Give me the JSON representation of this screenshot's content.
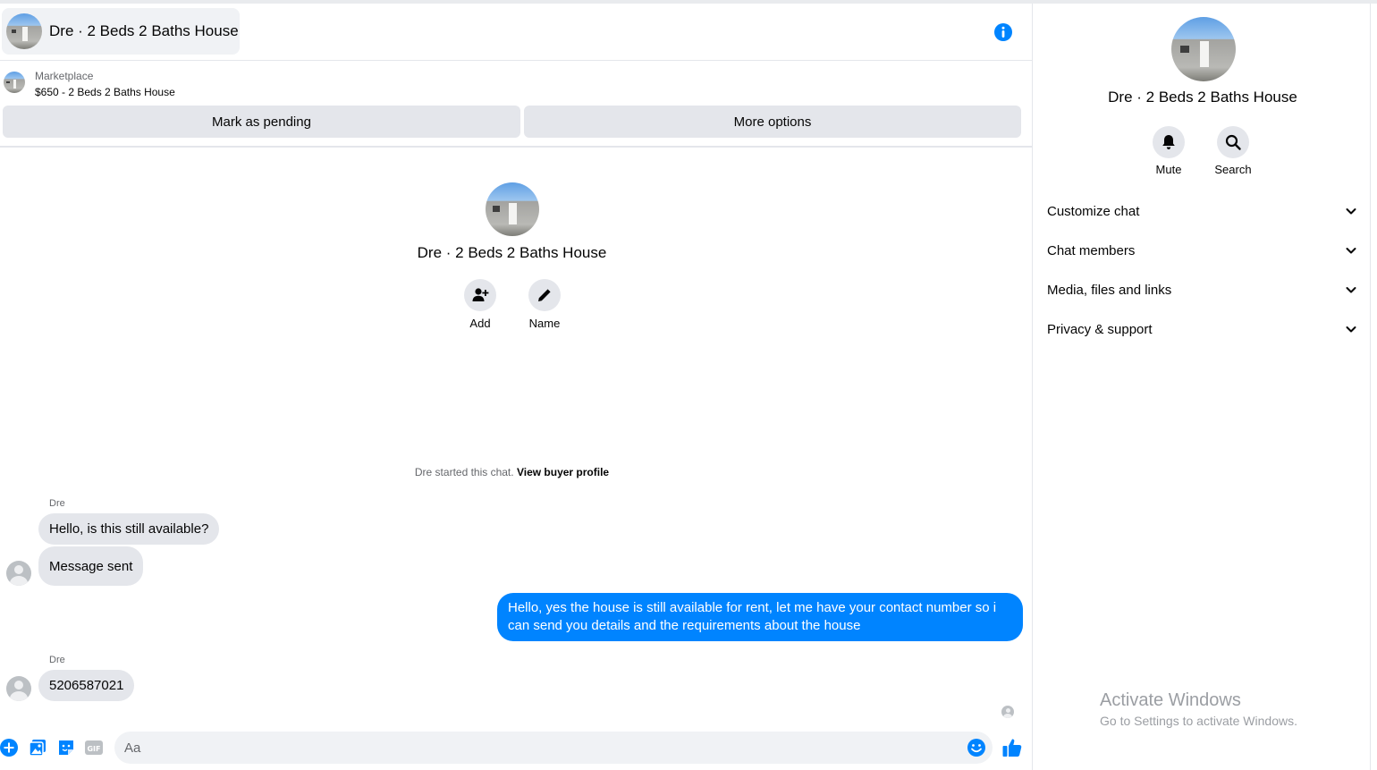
{
  "header": {
    "title": "Dre · 2 Beds 2 Baths House",
    "avatar_icon": "house-photo-icon",
    "info_icon": "info-icon"
  },
  "listing": {
    "source": "Marketplace",
    "price_title": "$650 - 2 Beds 2 Baths House",
    "mark_pending_label": "Mark as pending",
    "more_options_label": "More options"
  },
  "profile": {
    "title": "Dre · 2 Beds 2 Baths House",
    "add_label": "Add",
    "name_label": "Name"
  },
  "system": {
    "started_text": "Dre started this chat.",
    "view_buyer_label": "View buyer profile"
  },
  "messages": [
    {
      "sender": "Dre",
      "text": "Hello, is this still available?"
    },
    {
      "sender": "",
      "text": "Message sent"
    },
    {
      "sender": "me",
      "text": "Hello, yes the house is still available for rent, let me have your contact number so i can send you details and the requirements about the house"
    },
    {
      "sender": "Dre",
      "text": "5206587021"
    }
  ],
  "composer": {
    "placeholder": "Aa",
    "value": ""
  },
  "sidebar": {
    "title": "Dre · 2 Beds 2 Baths House",
    "mute_label": "Mute",
    "search_label": "Search",
    "sections": [
      {
        "label": "Customize chat"
      },
      {
        "label": "Chat members"
      },
      {
        "label": "Media, files and links"
      },
      {
        "label": "Privacy & support"
      }
    ]
  },
  "watermark": {
    "line1": "Activate Windows",
    "line2": "Go to Settings to activate Windows."
  },
  "colors": {
    "accent": "#0084ff",
    "bubble_in": "#e4e6eb",
    "secondary_text": "#65676b"
  }
}
